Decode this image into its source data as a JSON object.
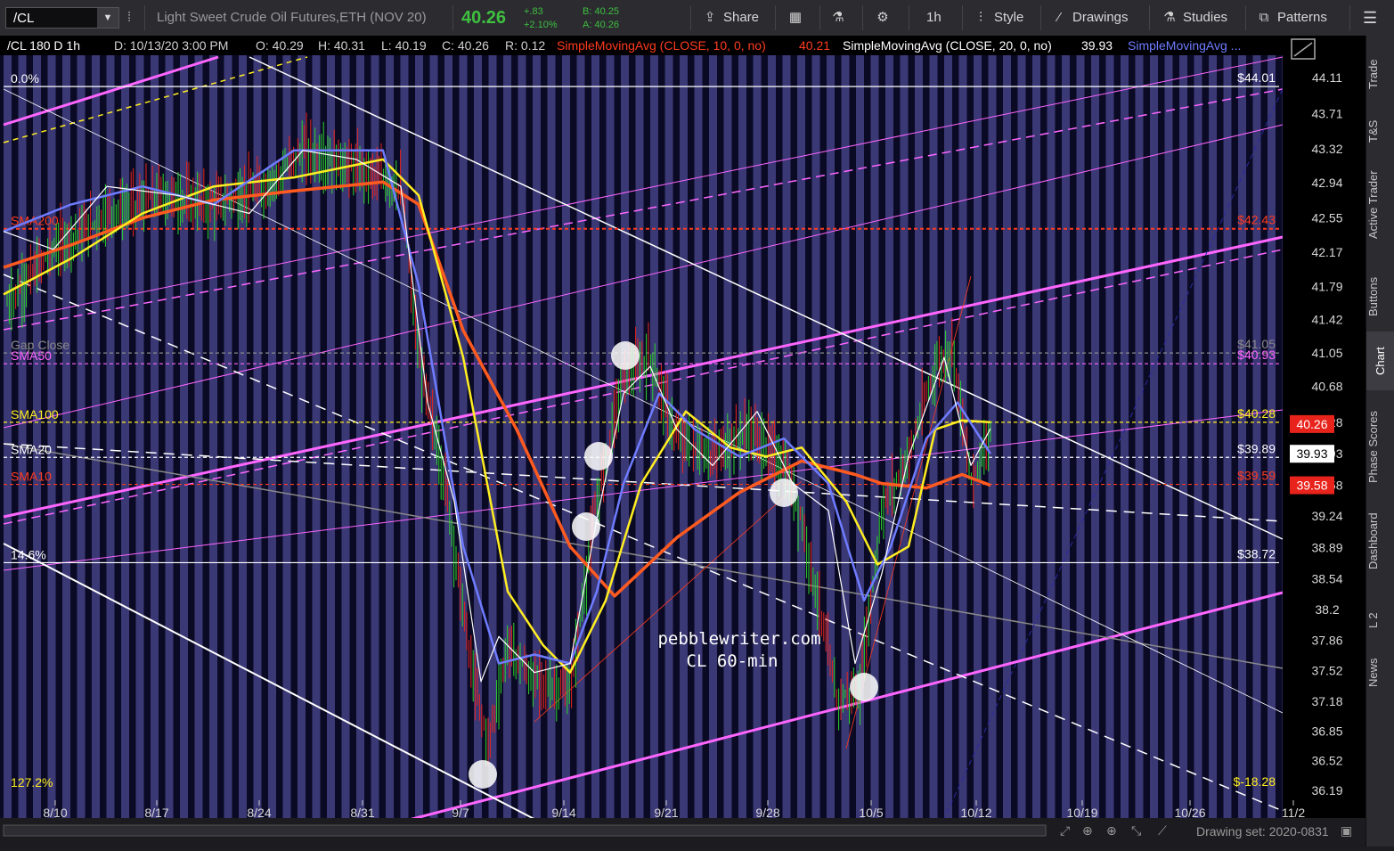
{
  "toolbar": {
    "symbol": "/CL",
    "description": "Light Sweet Crude Oil Futures,ETH (NOV 20)",
    "last": "40.26",
    "change": "+.83",
    "change_pct": "+2.10%",
    "bid": "B: 40.25",
    "ask": "A: 40.26",
    "share": "Share",
    "timeframe": "1h",
    "style": "Style",
    "drawings": "Drawings",
    "studies": "Studies",
    "patterns": "Patterns"
  },
  "header": {
    "sym": "/CL 180 D 1h",
    "date": "D: 10/13/20 3:00 PM",
    "open": "O: 40.29",
    "high": "H: 40.31",
    "low": "L: 40.19",
    "close": "C: 40.26",
    "range": "R: 0.12",
    "sma10_label": "SimpleMovingAvg (CLOSE, 10, 0, no)",
    "sma10_val": "40.21",
    "sma20_label": "SimpleMovingAvg (CLOSE, 20, 0, no)",
    "sma20_val": "39.93",
    "sma_more": "SimpleMovingAvg ..."
  },
  "sidebar": [
    "Trade",
    "T&S",
    "Active Trader",
    "Buttons",
    "Chart",
    "Phase Scores",
    "Dashboard",
    "L 2",
    "News"
  ],
  "status": {
    "drawing_set": "Drawing set: 2020-0831"
  },
  "watermark": {
    "line1": "pebblewriter.com",
    "line2": "CL 60-min"
  },
  "colors": {
    "sma10": "#ff3b1f",
    "sma20": "#ffffff",
    "sma50": "#5b6cff",
    "sma100": "#ffee22",
    "sma200": "#ff5a1f",
    "magenta": "#ff66ff",
    "background": "#000000"
  },
  "chart_data": {
    "type": "line",
    "x": [
      "8/10",
      "8/17",
      "8/24",
      "8/31",
      "9/7",
      "9/14",
      "9/21",
      "9/28",
      "10/5",
      "10/12",
      "10/19",
      "10/26",
      "11/2"
    ],
    "y_ticks": [
      44.11,
      43.71,
      43.32,
      42.94,
      42.55,
      42.17,
      41.79,
      41.42,
      41.05,
      40.68,
      40.28,
      39.93,
      39.58,
      39.24,
      38.89,
      38.54,
      38.2,
      37.86,
      37.52,
      37.18,
      36.85,
      36.52,
      36.19
    ],
    "ylim": [
      36.0,
      44.5
    ],
    "series": [
      {
        "name": "SMA20",
        "values": [
          42.0,
          42.8,
          42.9,
          43.2,
          39.5,
          37.9,
          40.6,
          40.1,
          38.3,
          40.0
        ]
      },
      {
        "name": "SMA10",
        "values": [
          42.2,
          42.9,
          43.0,
          43.2,
          39.0,
          37.7,
          40.8,
          40.0,
          38.2,
          40.2
        ]
      }
    ],
    "levels": [
      {
        "label": "0.0%",
        "value": 44.01,
        "price_label": "$44.01"
      },
      {
        "label": "SMA200",
        "value": 42.43,
        "price_label": "$42.43"
      },
      {
        "label": "Gap Close",
        "value": 41.05,
        "price_label": "$41.05"
      },
      {
        "label": "SMA50",
        "value": 40.93,
        "price_label": "$40.93"
      },
      {
        "label": "SMA100",
        "value": 40.28,
        "price_label": "$40.28"
      },
      {
        "label": "SMA20",
        "value": 39.89,
        "price_label": "$39.89"
      },
      {
        "label": "SMA10",
        "value": 39.59,
        "price_label": "$39.59"
      },
      {
        "label": "14.6%",
        "value": 38.72,
        "price_label": "$38.72"
      },
      {
        "label": "127.2%",
        "value": 36.19,
        "price_label": "$-18.28"
      }
    ],
    "price_markers": [
      {
        "label": "40.26",
        "color": "#e8231c"
      },
      {
        "label": "39.93",
        "color": "#ffffff"
      },
      {
        "label": "39.58",
        "color": "#e8231c"
      }
    ]
  }
}
